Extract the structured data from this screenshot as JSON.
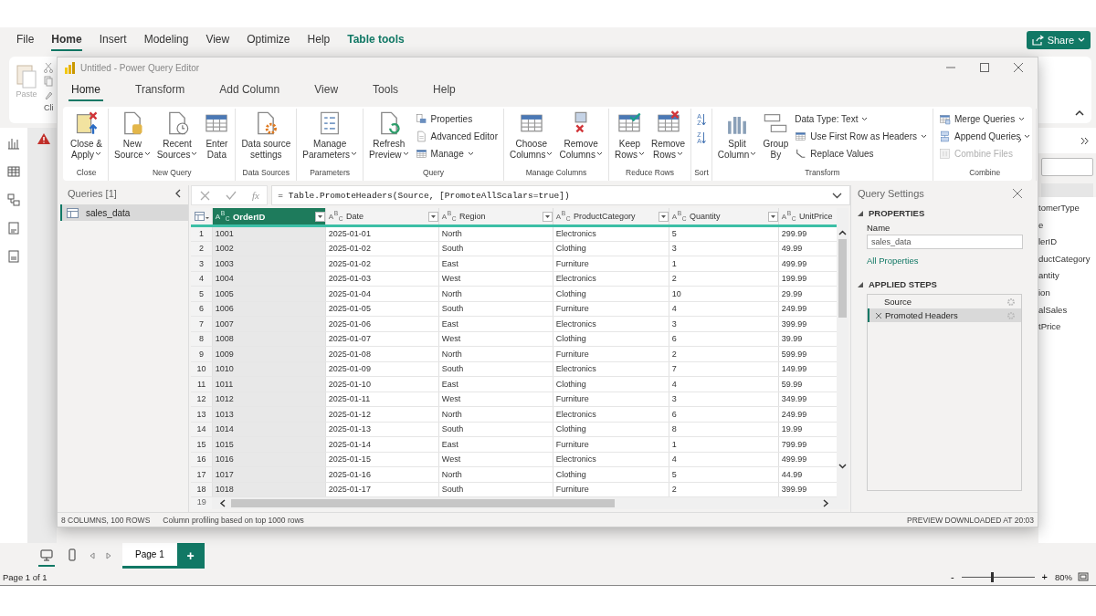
{
  "app_menu": [
    {
      "label": "File",
      "kind": "tab",
      "selected": false
    },
    {
      "label": "Home",
      "kind": "tab",
      "selected": true
    },
    {
      "label": "Insert",
      "kind": "tab",
      "selected": false
    },
    {
      "label": "Modeling",
      "kind": "tab",
      "selected": false
    },
    {
      "label": "View",
      "kind": "tab",
      "selected": false
    },
    {
      "label": "Optimize",
      "kind": "tab",
      "selected": false
    },
    {
      "label": "Help",
      "kind": "tab",
      "selected": false
    },
    {
      "label": "Table tools",
      "kind": "contextual",
      "selected": false
    }
  ],
  "share_button": "Share",
  "main_ribbon": {
    "paste": "Paste",
    "group_label": "Cli"
  },
  "fields_pane": {
    "fields": [
      "tomerType",
      "e",
      "lerID",
      "ductCategory",
      "antity",
      "ion",
      "alSales",
      "tPrice"
    ]
  },
  "editor": {
    "title": "Untitled - Power Query Editor",
    "tabs": [
      {
        "label": "Home",
        "selected": true
      },
      {
        "label": "Transform",
        "selected": false
      },
      {
        "label": "Add Column",
        "selected": false
      },
      {
        "label": "View",
        "selected": false
      },
      {
        "label": "Tools",
        "selected": false
      },
      {
        "label": "Help",
        "selected": false
      }
    ],
    "ribbon": {
      "groups": [
        {
          "label": "Close",
          "items": [
            {
              "kind": "large",
              "lines": [
                "Close &",
                "Apply"
              ],
              "dropdown": true
            }
          ]
        },
        {
          "label": "New Query",
          "items": [
            {
              "kind": "large",
              "lines": [
                "New",
                "Source"
              ],
              "dropdown": true
            },
            {
              "kind": "large",
              "lines": [
                "Recent",
                "Sources"
              ],
              "dropdown": true
            },
            {
              "kind": "large",
              "lines": [
                "Enter",
                "Data"
              ],
              "dropdown": false
            }
          ]
        },
        {
          "label": "Data Sources",
          "items": [
            {
              "kind": "large",
              "lines": [
                "Data source",
                "settings"
              ],
              "dropdown": false
            }
          ]
        },
        {
          "label": "Parameters",
          "items": [
            {
              "kind": "large",
              "lines": [
                "Manage",
                "Parameters"
              ],
              "dropdown": true
            }
          ]
        },
        {
          "label": "Query",
          "items": [
            {
              "kind": "large",
              "lines": [
                "Refresh",
                "Preview"
              ],
              "dropdown": true
            },
            {
              "kind": "stack",
              "items": [
                {
                  "kind": "small",
                  "label": "Properties",
                  "dropdown": false,
                  "disabled": false
                },
                {
                  "kind": "small",
                  "label": "Advanced Editor",
                  "dropdown": false,
                  "disabled": false
                },
                {
                  "kind": "small",
                  "label": "Manage",
                  "dropdown": true,
                  "disabled": false
                }
              ]
            }
          ]
        },
        {
          "label": "Manage Columns",
          "items": [
            {
              "kind": "large",
              "lines": [
                "Choose",
                "Columns"
              ],
              "dropdown": true
            },
            {
              "kind": "large",
              "lines": [
                "Remove",
                "Columns"
              ],
              "dropdown": true
            }
          ]
        },
        {
          "label": "Reduce Rows",
          "items": [
            {
              "kind": "large",
              "lines": [
                "Keep",
                "Rows"
              ],
              "dropdown": true
            },
            {
              "kind": "large",
              "lines": [
                "Remove",
                "Rows"
              ],
              "dropdown": true
            }
          ]
        },
        {
          "label": "Sort",
          "items": [
            {
              "kind": "stack",
              "items": [
                {
                  "kind": "sort",
                  "letters": [
                    "A",
                    "Z"
                  ]
                },
                {
                  "kind": "sort",
                  "letters": [
                    "Z",
                    "A"
                  ]
                }
              ]
            }
          ]
        },
        {
          "label": "Transform",
          "items": [
            {
              "kind": "large",
              "lines": [
                "Split",
                "Column"
              ],
              "dropdown": true
            },
            {
              "kind": "large",
              "lines": [
                "Group",
                "By"
              ],
              "dropdown": false
            },
            {
              "kind": "stack",
              "items": [
                {
                  "kind": "small",
                  "label": "Data Type: Text",
                  "dropdown": true,
                  "disabled": false
                },
                {
                  "kind": "small",
                  "label": "Use First Row as Headers",
                  "dropdown": true,
                  "disabled": false
                },
                {
                  "kind": "small",
                  "label": "Replace Values",
                  "dropdown": false,
                  "disabled": false
                }
              ]
            }
          ]
        },
        {
          "label": "Combine",
          "items": [
            {
              "kind": "stack",
              "items": [
                {
                  "kind": "small",
                  "label": "Merge Queries",
                  "dropdown": true,
                  "disabled": false
                },
                {
                  "kind": "small",
                  "label": "Append Queries",
                  "dropdown": true,
                  "disabled": false
                },
                {
                  "kind": "small",
                  "label": "Combine Files",
                  "dropdown": false,
                  "disabled": true
                }
              ]
            }
          ]
        }
      ]
    },
    "queries_panel": {
      "title": "Queries [1]",
      "items": [
        {
          "label": "sales_data",
          "selected": true
        }
      ]
    },
    "formula_bar": {
      "fx": "fx",
      "formula": "= Table.PromoteHeaders(Source, [PromoteAllScalars=true])"
    },
    "table": {
      "columns": [
        {
          "name": "OrderID",
          "type": "A$^{B}$$_{C}$",
          "selected": true
        },
        {
          "name": "Date",
          "type": "A$^{B}$$_{C}$",
          "selected": false
        },
        {
          "name": "Region",
          "type": "A$^{B}$$_{C}$",
          "selected": false
        },
        {
          "name": "ProductCategory",
          "type": "A$^{B}$$_{C}$",
          "selected": false
        },
        {
          "name": "Quantity",
          "type": "A$^{B}$$_{C}$",
          "selected": false
        },
        {
          "name": "UnitPrice",
          "type": "A$^{B}$$_{C}$",
          "selected": false
        }
      ],
      "rows": [
        {
          "number": "1",
          "cells": [
            "1001",
            "2025-01-01",
            "North",
            "Electronics",
            "5",
            "299.99"
          ]
        },
        {
          "number": "2",
          "cells": [
            "1002",
            "2025-01-02",
            "South",
            "Clothing",
            "3",
            "49.99"
          ]
        },
        {
          "number": "3",
          "cells": [
            "1003",
            "2025-01-02",
            "East",
            "Furniture",
            "1",
            "499.99"
          ]
        },
        {
          "number": "4",
          "cells": [
            "1004",
            "2025-01-03",
            "West",
            "Electronics",
            "2",
            "199.99"
          ]
        },
        {
          "number": "5",
          "cells": [
            "1005",
            "2025-01-04",
            "North",
            "Clothing",
            "10",
            "29.99"
          ]
        },
        {
          "number": "6",
          "cells": [
            "1006",
            "2025-01-05",
            "South",
            "Furniture",
            "4",
            "249.99"
          ]
        },
        {
          "number": "7",
          "cells": [
            "1007",
            "2025-01-06",
            "East",
            "Electronics",
            "3",
            "399.99"
          ]
        },
        {
          "number": "8",
          "cells": [
            "1008",
            "2025-01-07",
            "West",
            "Clothing",
            "6",
            "39.99"
          ]
        },
        {
          "number": "9",
          "cells": [
            "1009",
            "2025-01-08",
            "North",
            "Furniture",
            "2",
            "599.99"
          ]
        },
        {
          "number": "10",
          "cells": [
            "1010",
            "2025-01-09",
            "South",
            "Electronics",
            "7",
            "149.99"
          ]
        },
        {
          "number": "11",
          "cells": [
            "1011",
            "2025-01-10",
            "East",
            "Clothing",
            "4",
            "59.99"
          ]
        },
        {
          "number": "12",
          "cells": [
            "1012",
            "2025-01-11",
            "West",
            "Furniture",
            "3",
            "349.99"
          ]
        },
        {
          "number": "13",
          "cells": [
            "1013",
            "2025-01-12",
            "North",
            "Electronics",
            "6",
            "249.99"
          ]
        },
        {
          "number": "14",
          "cells": [
            "1014",
            "2025-01-13",
            "South",
            "Clothing",
            "8",
            "19.99"
          ]
        },
        {
          "number": "15",
          "cells": [
            "1015",
            "2025-01-14",
            "East",
            "Furniture",
            "1",
            "799.99"
          ]
        },
        {
          "number": "16",
          "cells": [
            "1016",
            "2025-01-15",
            "West",
            "Electronics",
            "4",
            "499.99"
          ]
        },
        {
          "number": "17",
          "cells": [
            "1017",
            "2025-01-16",
            "North",
            "Clothing",
            "5",
            "44.99"
          ]
        },
        {
          "number": "18",
          "cells": [
            "1018",
            "2025-01-17",
            "South",
            "Furniture",
            "2",
            "399.99"
          ]
        }
      ],
      "partial_row_number": "19"
    },
    "query_settings": {
      "title": "Query Settings",
      "properties_heading": "PROPERTIES",
      "name_label": "Name",
      "name_value": "sales_data",
      "all_properties": "All Properties",
      "steps_heading": "APPLIED STEPS",
      "steps": [
        {
          "label": "Source",
          "selected": false
        },
        {
          "label": "Promoted Headers",
          "selected": true
        }
      ]
    },
    "status": {
      "summary": "8 COLUMNS, 100 ROWS",
      "profiling": "Column profiling based on top 1000 rows",
      "preview": "PREVIEW DOWNLOADED AT 20:03"
    }
  },
  "page_bar": {
    "pages": [
      {
        "label": "Page 1",
        "selected": true
      }
    ],
    "add_page": "+"
  },
  "status_bar": {
    "page": "Page 1 of 1",
    "zoom_out": "-",
    "zoom_in": "+",
    "level": 0.4,
    "zoom": "80%"
  }
}
